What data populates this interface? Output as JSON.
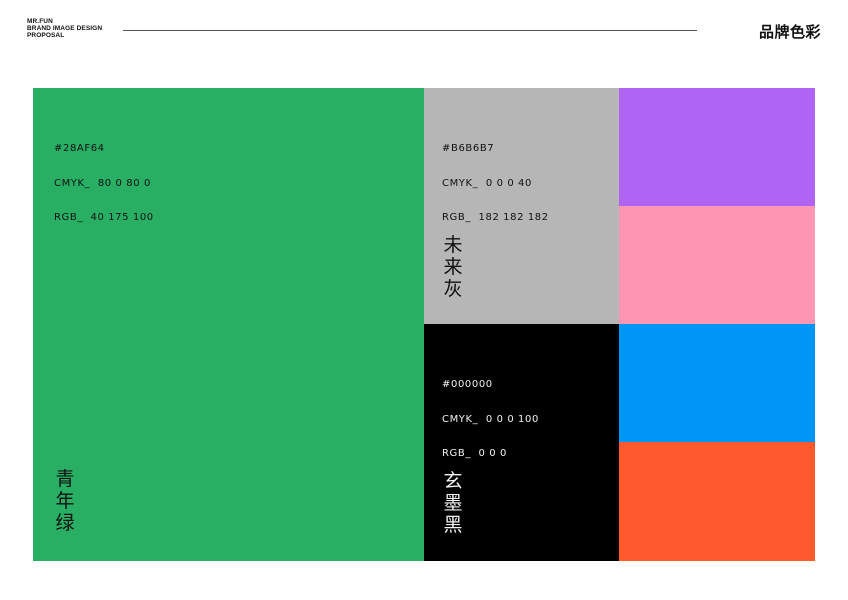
{
  "header": {
    "brand_lines": [
      "MR.FUN",
      "BRAND IMAGE DESIGN",
      "PROPOSAL"
    ],
    "section_title": "品牌色彩"
  },
  "swatches": [
    {
      "id": "green",
      "color": "#28AF64",
      "hex": "#28AF64",
      "cmyk": "CMYK_  80 0 80 0",
      "rgb": "RGB_  40 175 100",
      "name_chars": [
        "青",
        "年",
        "绿"
      ],
      "text_color": "#111111"
    },
    {
      "id": "gray",
      "color": "#B6B6B7",
      "hex": "#B6B6B7",
      "cmyk": "CMYK_  0 0 0 40",
      "rgb": "RGB_  182 182 182",
      "name_chars": [
        "未",
        "来",
        "灰"
      ],
      "text_color": "#111111"
    },
    {
      "id": "black",
      "color": "#000000",
      "hex": "#000000",
      "cmyk": "CMYK_  0 0 0 100",
      "rgb": "RGB_  0 0 0",
      "name_chars": [
        "玄",
        "墨",
        "黑"
      ],
      "text_color": "#f2f2f2"
    }
  ],
  "accents": [
    {
      "id": "purple",
      "color": "#AF64F5"
    },
    {
      "id": "pink",
      "color": "#FF96B4"
    },
    {
      "id": "blue",
      "color": "#0096F5"
    },
    {
      "id": "orange",
      "color": "#FF5A2D"
    }
  ]
}
